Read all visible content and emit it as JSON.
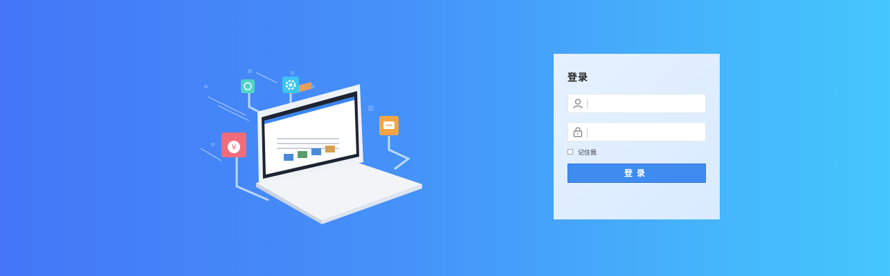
{
  "login": {
    "title": "登录",
    "username": {
      "value": "",
      "placeholder": ""
    },
    "password": {
      "value": "",
      "placeholder": ""
    },
    "remember_label": "记住我",
    "submit_label": "登录"
  },
  "colors": {
    "background_start": "#4476f7",
    "background_end": "#45c6fd",
    "panel": "#e1efff",
    "button": "#3f8cf0"
  }
}
